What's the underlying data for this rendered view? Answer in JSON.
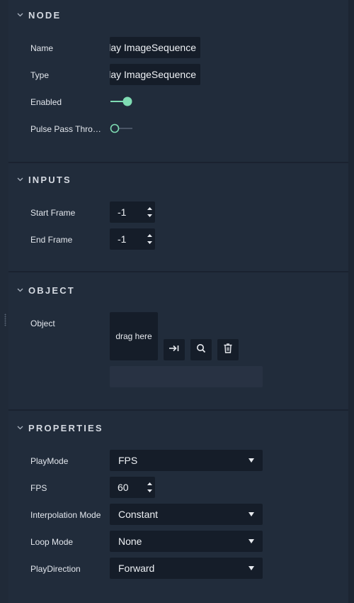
{
  "sections": {
    "node": {
      "title": "NODE"
    },
    "inputs": {
      "title": "INPUTS"
    },
    "object": {
      "title": "OBJECT"
    },
    "properties": {
      "title": "PROPERTIES"
    }
  },
  "node": {
    "name": {
      "label": "Name",
      "value": "lay ImageSequence"
    },
    "type": {
      "label": "Type",
      "value": "lay ImageSequence"
    },
    "enabled": {
      "label": "Enabled",
      "on": true
    },
    "pulse_pass_through": {
      "label": "Pulse Pass Throu...",
      "on": false
    }
  },
  "inputs": {
    "start_frame": {
      "label": "Start Frame",
      "value": "-1"
    },
    "end_frame": {
      "label": "End Frame",
      "value": "-1"
    }
  },
  "object": {
    "label": "Object",
    "drop_text": "drag here",
    "path_value": "",
    "buttons": [
      "assign-icon",
      "search-icon",
      "trash-icon"
    ]
  },
  "properties": {
    "play_mode": {
      "label": "PlayMode",
      "value": "FPS"
    },
    "fps": {
      "label": "FPS",
      "value": "60"
    },
    "interpolation_mode": {
      "label": "Interpolation Mode",
      "value": "Constant"
    },
    "loop_mode": {
      "label": "Loop Mode",
      "value": "None"
    },
    "play_direction": {
      "label": "PlayDirection",
      "value": "Forward"
    }
  },
  "colors": {
    "accent": "#7fdcb3",
    "panel": "#212c3b",
    "field": "#151d29",
    "background": "#202a38"
  }
}
